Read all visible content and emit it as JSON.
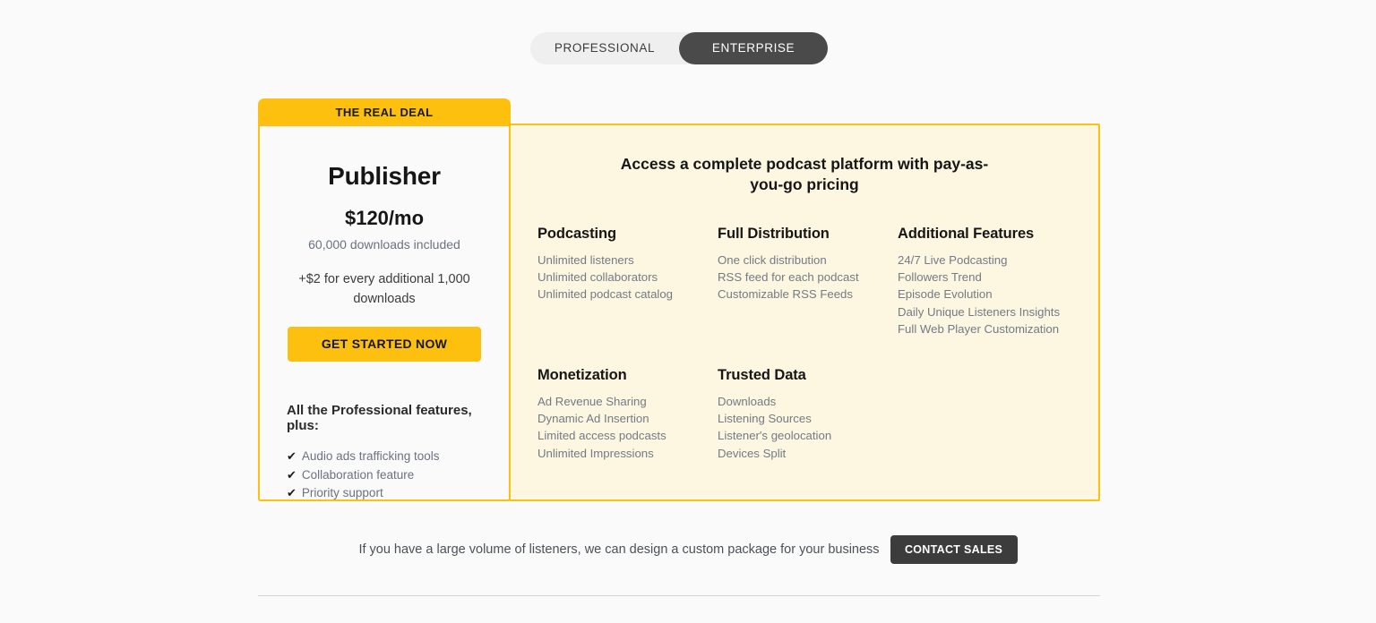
{
  "toggle": {
    "options": [
      {
        "label": "PROFESSIONAL",
        "active": false
      },
      {
        "label": "ENTERPRISE",
        "active": true
      }
    ]
  },
  "plan": {
    "ribbon_label": "THE REAL DEAL",
    "name": "Publisher",
    "price": "$120/mo",
    "included": "60,000 downloads included",
    "overage": "+$2 for every additional 1,000 downloads",
    "cta_label": "GET STARTED NOW",
    "plus_title": "All the Professional features, plus:",
    "tick_glyph": "✔",
    "plus_features": [
      "Audio ads trafficking tools",
      "Collaboration feature",
      "Priority support"
    ]
  },
  "features_panel": {
    "heading": "Access a complete podcast platform with pay-as-you-go pricing",
    "columns": [
      {
        "title": "Podcasting",
        "items": [
          "Unlimited listeners",
          "Unlimited collaborators",
          "Unlimited podcast catalog"
        ]
      },
      {
        "title": "Full Distribution",
        "items": [
          "One click distribution",
          "RSS feed for each podcast",
          "Customizable RSS Feeds"
        ]
      },
      {
        "title": "Additional Features",
        "items": [
          "24/7 Live Podcasting",
          "Followers Trend",
          "Episode Evolution",
          "Daily Unique Listeners Insights",
          "Full Web Player Customization"
        ]
      },
      {
        "title": "Monetization",
        "items": [
          "Ad Revenue Sharing",
          "Dynamic Ad Insertion",
          "Limited access podcasts",
          "Unlimited Impressions"
        ]
      },
      {
        "title": "Trusted Data",
        "items": [
          "Downloads",
          "Listening Sources",
          "Listener's geolocation",
          "Devices Split"
        ]
      }
    ]
  },
  "contact": {
    "text": "If you have a large volume of listeners, we can design a custom package for your business",
    "button_label": "CONTACT SALES"
  },
  "colors": {
    "accent_yellow": "#fdc00f",
    "panel_cream": "#fdf6e0",
    "dark": "#3c3c3c",
    "page_bg": "#fafafa",
    "muted_text": "#737b86"
  }
}
